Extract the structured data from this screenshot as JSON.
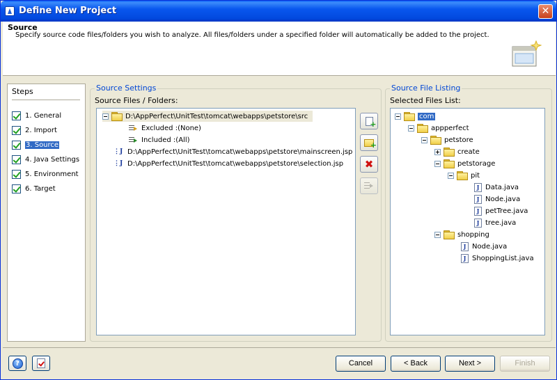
{
  "window": {
    "title": "Define New Project",
    "close_glyph": "✕"
  },
  "header": {
    "title": "Source",
    "description": "Specify source code files/folders you wish to analyze. All files/folders under a specified folder will automatically be added to the project."
  },
  "steps": {
    "title": "Steps",
    "items": [
      {
        "label": "1. General",
        "checked": true,
        "selected": false
      },
      {
        "label": "2. Import",
        "checked": true,
        "selected": false
      },
      {
        "label": "3. Source",
        "checked": true,
        "selected": true
      },
      {
        "label": "4. Java Settings",
        "checked": true,
        "selected": false
      },
      {
        "label": "5. Environment",
        "checked": true,
        "selected": false
      },
      {
        "label": "6. Target",
        "checked": true,
        "selected": false
      }
    ]
  },
  "source_settings": {
    "group_title": "Source Settings",
    "list_label": "Source Files / Folders:",
    "tree": {
      "root": "D:\\AppPerfect\\UnitTest\\tomcat\\webapps\\petstore\\src",
      "excluded": "Excluded :(None)",
      "included": "Included :(All)",
      "files": [
        "D:\\AppPerfect\\UnitTest\\tomcat\\webapps\\petstore\\mainscreen.jsp",
        "D:\\AppPerfect\\UnitTest\\tomcat\\webapps\\petstore\\selection.jsp"
      ]
    },
    "jsp_icon_glyph": "⋮J"
  },
  "source_listing": {
    "group_title": "Source File Listing",
    "list_label": "Selected Files List:",
    "tree": {
      "com": "com",
      "appperfect": "appperfect",
      "petstore": "petstore",
      "create": "create",
      "petstorage": "petstorage",
      "pit": "pit",
      "pit_files": [
        "Data.java",
        "Node.java",
        "petTree.java",
        "tree.java"
      ],
      "shopping": "shopping",
      "shopping_files": [
        "Node.java",
        "ShoppingList.java"
      ]
    },
    "java_icon_glyph": "J"
  },
  "footer": {
    "help_glyph": "?",
    "cancel": "Cancel",
    "back": "< Back",
    "next": "Next >",
    "finish": "Finish"
  }
}
